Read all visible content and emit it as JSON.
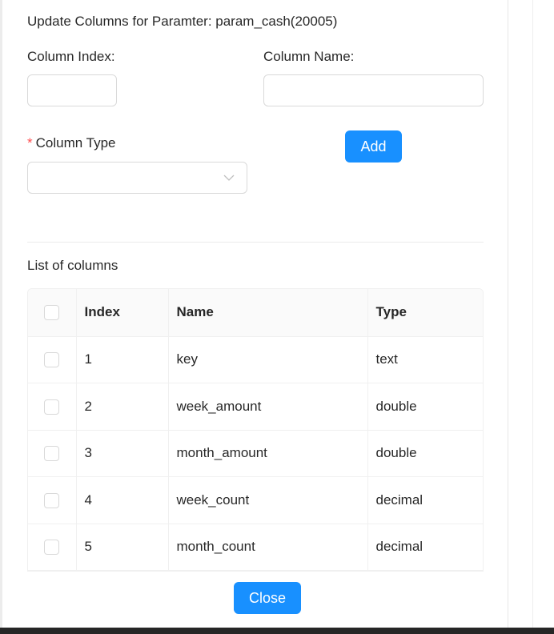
{
  "title": "Update Columns for Paramter: param_cash(20005)",
  "form": {
    "column_index_label": "Column Index:",
    "column_index_value": "",
    "column_name_label": "Column Name:",
    "column_name_value": "",
    "column_type_required_mark": "*",
    "column_type_label": "Column Type",
    "column_type_value": "",
    "add_label": "Add"
  },
  "list_title": "List of columns",
  "table": {
    "headers": [
      "Index",
      "Name",
      "Type"
    ],
    "rows": [
      {
        "index": "1",
        "name": "key",
        "type": "text"
      },
      {
        "index": "2",
        "name": "week_amount",
        "type": "double"
      },
      {
        "index": "3",
        "name": "month_amount",
        "type": "double"
      },
      {
        "index": "4",
        "name": "week_count",
        "type": "decimal"
      },
      {
        "index": "5",
        "name": "month_count",
        "type": "decimal"
      }
    ]
  },
  "close_label": "Close",
  "colors": {
    "primary": "#1890ff",
    "required": "#ff4d4f",
    "border": "#d9d9d9"
  },
  "icons": {
    "select_arrow": "chevron-down-icon"
  }
}
